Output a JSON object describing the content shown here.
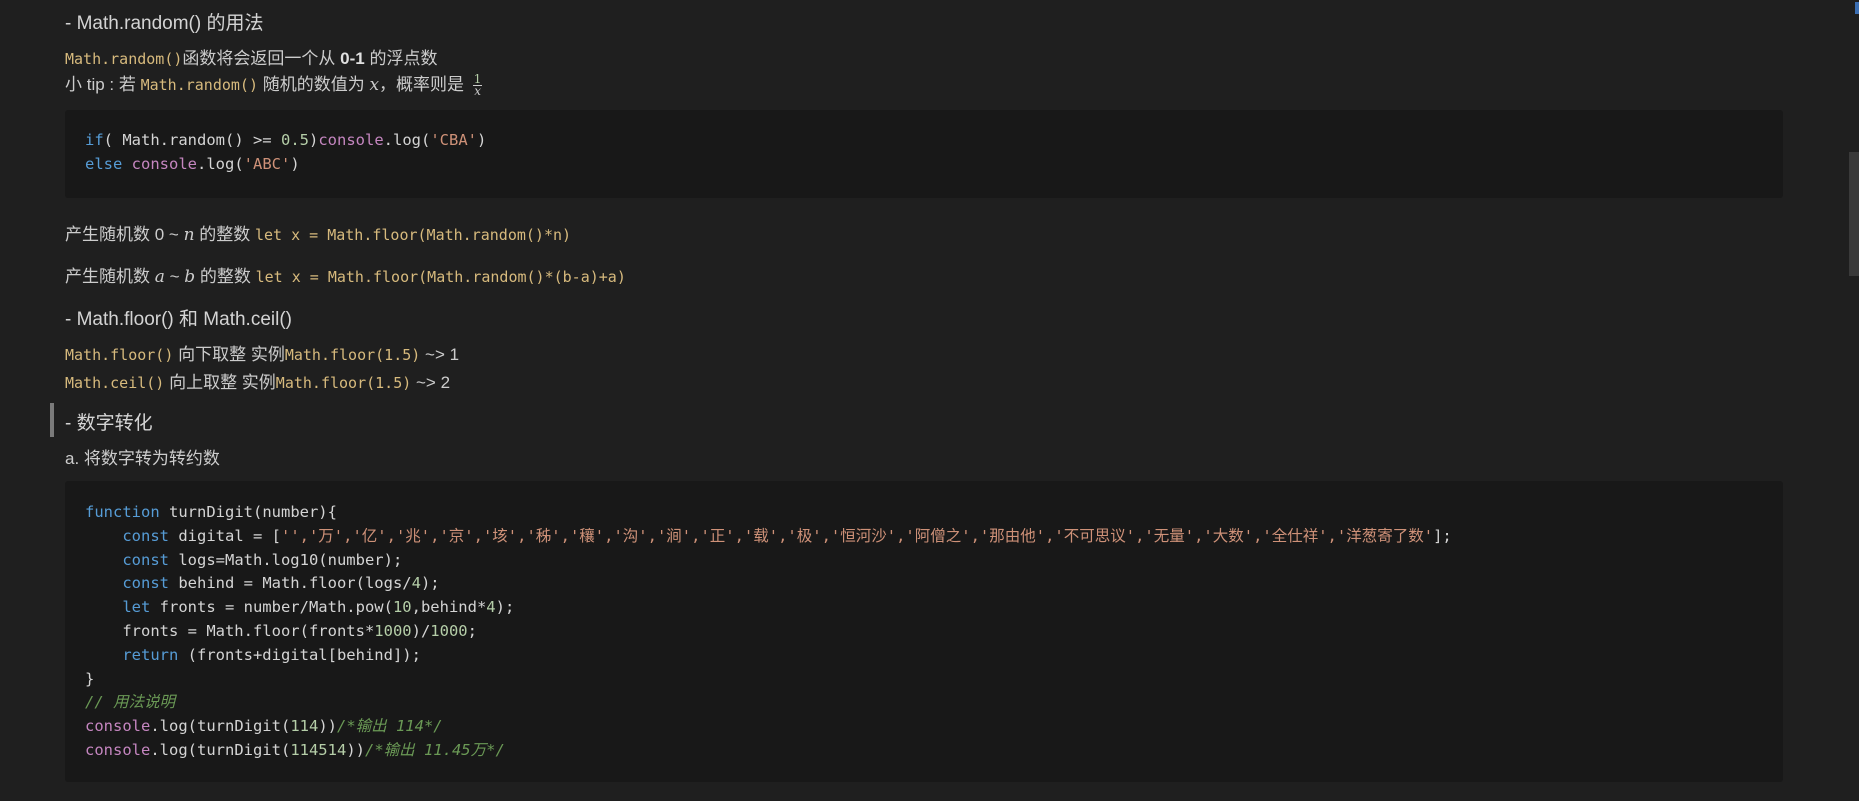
{
  "section1": {
    "heading": "- Math.random() 的用法",
    "line1_code": "Math.random()",
    "line1_text_a": "函数将会返回一个从 ",
    "line1_bold": "0-1",
    "line1_text_b": " 的浮点数",
    "line2_text_a": "小 tip : 若 ",
    "line2_code": "Math.random()",
    "line2_text_b": " 随机的数值为 ",
    "line2_var": "x",
    "line2_text_c": "，概率则是 ",
    "frac_num": "1",
    "frac_den": "x",
    "code_lines": [
      [
        {
          "t": "if",
          "c": "kw"
        },
        {
          "t": "( Math.random() >= ",
          "c": "fn"
        },
        {
          "t": "0.5",
          "c": "num"
        },
        {
          "t": ")",
          "c": "fn"
        },
        {
          "t": "console",
          "c": "kw2"
        },
        {
          "t": ".log(",
          "c": "fn"
        },
        {
          "t": "'CBA'",
          "c": "str"
        },
        {
          "t": ")",
          "c": "fn"
        }
      ],
      [
        {
          "t": "else ",
          "c": "kw"
        },
        {
          "t": "console",
          "c": "kw2"
        },
        {
          "t": ".log(",
          "c": "fn"
        },
        {
          "t": "'ABC'",
          "c": "str"
        },
        {
          "t": ")",
          "c": "fn"
        }
      ]
    ]
  },
  "random_0n": {
    "text_a": "产生随机数 0 ~ ",
    "var": "n",
    "text_b": " 的整数 ",
    "code": "let x = Math.floor(Math.random()*n)"
  },
  "random_ab": {
    "text_a": "产生随机数 ",
    "var_a": "a",
    "sep": " ~ ",
    "var_b": "b",
    "text_b": " 的整数 ",
    "code": "let x = Math.floor(Math.random()*(b-a)+a)"
  },
  "section2": {
    "heading": "- Math.floor() 和 Math.ceil()",
    "floor_code": "Math.floor()",
    "floor_text": " 向下取整 实例",
    "floor_example": "Math.floor(1.5)",
    "floor_result": " ~> 1",
    "ceil_code": "Math.ceil()",
    "ceil_text": " 向上取整 实例",
    "ceil_example": "Math.floor(1.5)",
    "ceil_result": " ~> 2"
  },
  "section3": {
    "heading": "- 数字转化",
    "sub": "a. 将数字转为转约数",
    "code_lines": [
      [
        {
          "t": "function ",
          "c": "kw"
        },
        {
          "t": "turnDigit(number){",
          "c": "fn"
        }
      ],
      [
        {
          "t": "    ",
          "c": "fn"
        },
        {
          "t": "const ",
          "c": "kw"
        },
        {
          "t": "digital = [",
          "c": "fn"
        },
        {
          "t": "'','万','亿','兆','京','垓','秭','穰','沟','涧','正','载','极','恒河沙','阿僧之','那由他','不可思议','无量','大数','全仕祥','洋葱寄了数'",
          "c": "str"
        },
        {
          "t": "];",
          "c": "fn"
        }
      ],
      [
        {
          "t": "    ",
          "c": "fn"
        },
        {
          "t": "const ",
          "c": "kw"
        },
        {
          "t": "logs=Math.log10(number);",
          "c": "fn"
        }
      ],
      [
        {
          "t": "    ",
          "c": "fn"
        },
        {
          "t": "const ",
          "c": "kw"
        },
        {
          "t": "behind = Math.floor(logs/",
          "c": "fn"
        },
        {
          "t": "4",
          "c": "num"
        },
        {
          "t": ");",
          "c": "fn"
        }
      ],
      [
        {
          "t": "    ",
          "c": "fn"
        },
        {
          "t": "let ",
          "c": "kw"
        },
        {
          "t": "fronts = number/Math.pow(",
          "c": "fn"
        },
        {
          "t": "10",
          "c": "num"
        },
        {
          "t": ",behind*",
          "c": "fn"
        },
        {
          "t": "4",
          "c": "num"
        },
        {
          "t": ");",
          "c": "fn"
        }
      ],
      [
        {
          "t": "    fronts = Math.floor(fronts*",
          "c": "fn"
        },
        {
          "t": "1000",
          "c": "num"
        },
        {
          "t": ")/",
          "c": "fn"
        },
        {
          "t": "1000",
          "c": "num"
        },
        {
          "t": ";",
          "c": "fn"
        }
      ],
      [
        {
          "t": "    ",
          "c": "fn"
        },
        {
          "t": "return ",
          "c": "kw"
        },
        {
          "t": "(fronts+digital[behind]);",
          "c": "fn"
        }
      ],
      [
        {
          "t": "}",
          "c": "fn"
        }
      ],
      [
        {
          "t": "// 用法说明",
          "c": "com"
        }
      ],
      [
        {
          "t": "console",
          "c": "kw2"
        },
        {
          "t": ".log(turnDigit(",
          "c": "fn"
        },
        {
          "t": "114",
          "c": "num"
        },
        {
          "t": "))",
          "c": "fn"
        },
        {
          "t": "/*输出 114*/",
          "c": "com"
        }
      ],
      [
        {
          "t": "console",
          "c": "kw2"
        },
        {
          "t": ".log(turnDigit(",
          "c": "fn"
        },
        {
          "t": "114514",
          "c": "num"
        },
        {
          "t": "))",
          "c": "fn"
        },
        {
          "t": "/*输出 11.45万*/",
          "c": "com"
        }
      ]
    ]
  },
  "colors": {
    "background": "#1f1f1f",
    "code_background": "#181818",
    "inline_code": "#d7ba7d",
    "keyword": "#569cd6",
    "string": "#ce9178",
    "number": "#b5cea8",
    "comment": "#6a9955"
  }
}
